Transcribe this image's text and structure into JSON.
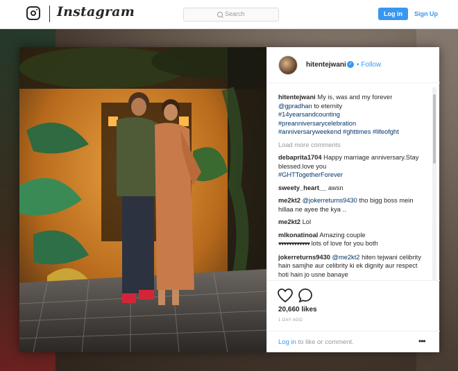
{
  "header": {
    "brand": "Instagram",
    "search_placeholder": "Search",
    "login_label": "Log in",
    "signup_label": "Sign Up"
  },
  "post": {
    "username": "hitentejwani",
    "follow_label": "Follow",
    "separator": "•",
    "caption": {
      "author": "hitentejwani",
      "text": "My is, was and my forever",
      "mention": "@gpradhan",
      "text2": "to eternity",
      "tags": [
        "#14yearsandcounting",
        "#preanniversarycelebration",
        "#anniversaryweekend",
        "#ghttimes",
        "#lifeofght"
      ]
    },
    "load_more": "Load more comments",
    "comments": [
      {
        "user": "debaprita1704",
        "text": "Happy marriage anniversary.Stay blessed.love you",
        "tag": "#GHTTogetherForever"
      },
      {
        "user": "sweety_heart__",
        "text": "awsn"
      },
      {
        "user": "me2kt2",
        "mention": "@jokerreturns9430",
        "text": "tho bigg boss mein hillaa ne ayee the kya .."
      },
      {
        "user": "me2kt2",
        "text": "Lol"
      },
      {
        "user": "mlkonatinoal",
        "text": "Amazing couple",
        "text2": "lots of love for you both"
      },
      {
        "user": "jokerreturns9430",
        "mention": "@me2kt2",
        "text": "hiten tejwani celibrity hain samjhe aur celibrity ki ek dignity aur respect hoti hain jo usne banaye"
      }
    ],
    "likes": "20,660 likes",
    "time": "1 DAY AGO",
    "login_link": "Log in",
    "login_rest": "to like or comment.",
    "more_icon": "•••"
  },
  "colors": {
    "accent": "#3897f0",
    "text": "#262626",
    "muted": "#999999",
    "tag": "#003569"
  }
}
